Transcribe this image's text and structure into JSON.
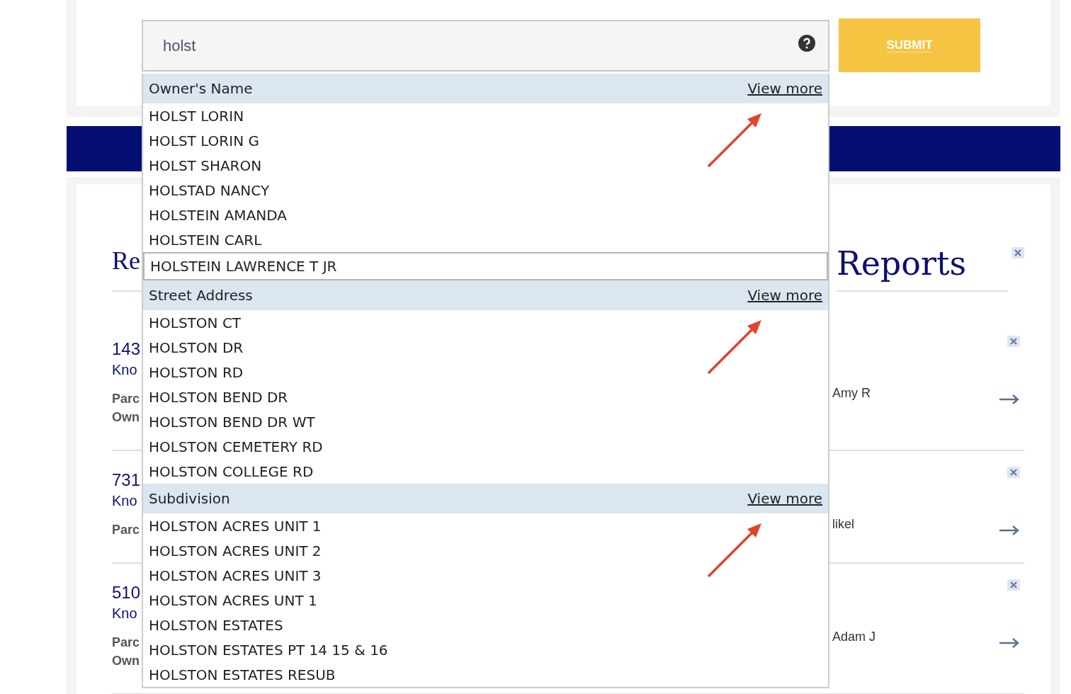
{
  "search": {
    "value": "holst"
  },
  "submit_button": "SUBMIT",
  "left_title": "Re",
  "right_title": "Reports",
  "results": [
    {
      "number": "143",
      "city": "Kno",
      "labels": [
        "Parc",
        "Own"
      ],
      "owner": "Amy R"
    },
    {
      "number": "731",
      "city": "Kno",
      "labels": [
        "Parc"
      ],
      "owner": "likel"
    },
    {
      "number": "510",
      "city": "Kno",
      "labels": [
        "Parc",
        "Own"
      ],
      "owner": "Adam J"
    }
  ],
  "suggestions": {
    "groups": [
      {
        "title": "Owner's Name",
        "link": "View more",
        "annotated": true,
        "items": [
          {
            "label": "HOLST LORIN",
            "selected": false
          },
          {
            "label": "HOLST LORIN G",
            "selected": false
          },
          {
            "label": "HOLST SHARON",
            "selected": false
          },
          {
            "label": "HOLSTAD NANCY",
            "selected": false
          },
          {
            "label": "HOLSTEIN AMANDA",
            "selected": false
          },
          {
            "label": "HOLSTEIN CARL",
            "selected": false
          },
          {
            "label": "HOLSTEIN LAWRENCE T JR",
            "selected": true
          }
        ]
      },
      {
        "title": "Street Address",
        "link": "View more",
        "annotated": true,
        "items": [
          {
            "label": "HOLSTON CT",
            "selected": false
          },
          {
            "label": "HOLSTON DR",
            "selected": false
          },
          {
            "label": "HOLSTON RD",
            "selected": false
          },
          {
            "label": "HOLSTON BEND DR",
            "selected": false
          },
          {
            "label": "HOLSTON BEND DR WT",
            "selected": false
          },
          {
            "label": "HOLSTON CEMETERY RD",
            "selected": false
          },
          {
            "label": "HOLSTON COLLEGE RD",
            "selected": false
          }
        ]
      },
      {
        "title": "Subdivision",
        "link": "View more",
        "annotated": true,
        "items": [
          {
            "label": "HOLSTON ACRES UNIT 1",
            "selected": false
          },
          {
            "label": "HOLSTON ACRES UNIT 2",
            "selected": false
          },
          {
            "label": "HOLSTON ACRES UNIT 3",
            "selected": false
          },
          {
            "label": "HOLSTON ACRES UNT 1",
            "selected": false
          },
          {
            "label": "HOLSTON ESTATES",
            "selected": false
          },
          {
            "label": "HOLSTON ESTATES PT 14 15 & 16",
            "selected": false
          },
          {
            "label": "HOLSTON ESTATES RESUB",
            "selected": false
          }
        ]
      }
    ]
  }
}
